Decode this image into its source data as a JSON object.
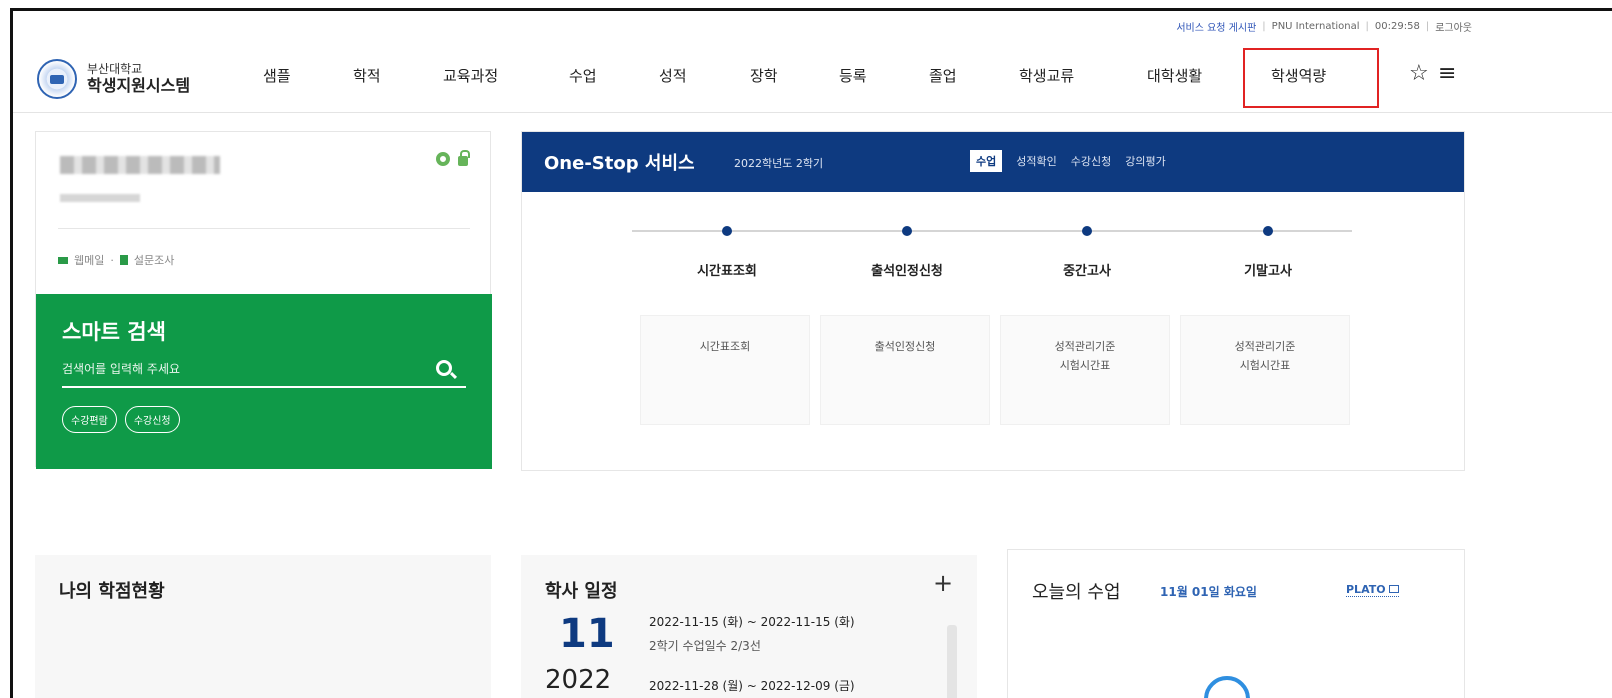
{
  "utility": {
    "service_board": "서비스 요청 게시판",
    "international": "PNU International",
    "timer": "00:29:58",
    "logout": "로그아웃"
  },
  "logo": {
    "line1": "부산대학교",
    "line2": "학생지원시스템"
  },
  "nav": {
    "items": [
      "샘플",
      "학적",
      "교육과정",
      "수업",
      "성적",
      "장학",
      "등록",
      "졸업",
      "학생교류",
      "대학생활",
      "학생역량"
    ],
    "highlighted": "학생역량",
    "highlight_color": "#e12323"
  },
  "icons": {
    "favorite": "☆",
    "menu": "≡"
  },
  "profile": {
    "webmail": "웹메일",
    "survey": "설문조사"
  },
  "smart_search": {
    "title": "스마트 검색",
    "placeholder": "검색어를 입력해 주세요",
    "chips": [
      "수강편람",
      "수강신청"
    ],
    "bg_color": "#0f9a48"
  },
  "onestop": {
    "title": "One-Stop 서비스",
    "term": "2022학년도 2학기",
    "tabs": [
      "수업",
      "성적확인",
      "수강신청",
      "강의평가"
    ],
    "active_tab": "수업",
    "steps": [
      "시간표조회",
      "출석인정신청",
      "중간고사",
      "기말고사"
    ],
    "boxes": [
      [
        "시간표조회"
      ],
      [
        "출석인정신청"
      ],
      [
        "성적관리기준",
        "시험시간표"
      ],
      [
        "성적관리기준",
        "시험시간표"
      ]
    ],
    "bar_color": "#0e3a80"
  },
  "credits": {
    "title": "나의 학점현황"
  },
  "schedule": {
    "title": "학사 일정",
    "plus": "+",
    "month": "11",
    "year": "2022",
    "event1_range": "2022-11-15 (화) ~ 2022-11-15 (화)",
    "event1_name": "2학기 수업일수 2/3선",
    "event2_range": "2022-11-28 (월) ~ 2022-12-09 (금)"
  },
  "today_class": {
    "title": "오늘의 수업",
    "date": "11월 01일 화요일",
    "plato": "PLATO"
  }
}
